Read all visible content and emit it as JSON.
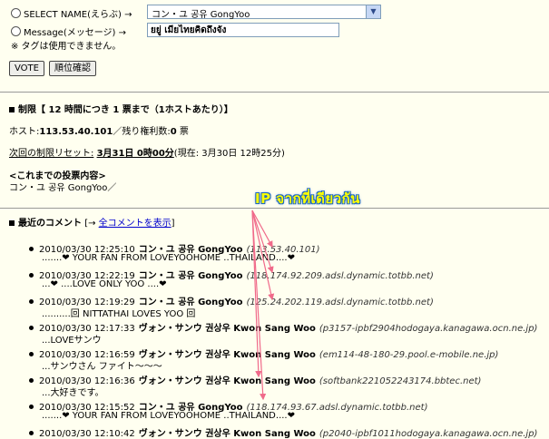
{
  "vote_form": {
    "select_label": "SELECT NAME(えらぶ)",
    "arrow": "→",
    "select_value": "コン・ユ  공유  GongYoo",
    "message_label": "Message(メッセージ)",
    "message_value": "ยยู่ เมียไทยคิดถึงจัง",
    "notice": "※ タグは使用できません。",
    "vote_button": "VOTE",
    "rank_button": "順位確認"
  },
  "limits": {
    "title": "制限【 12 時間につき 1 票まで（1ホストあたり）】",
    "host_line_prefix": "ホスト:",
    "host": "113.53.40.101",
    "remaining_label": "／残り権利数:",
    "remaining": "0",
    "remaining_unit": "票",
    "reset_label": "次回の制限リセット:",
    "reset_time": "3月31日 0時00分",
    "now_text": "(現在: 3月30日 12時25分)",
    "history_title": "<これまでの投票内容>",
    "history_value": "コン・ユ  공유  GongYoo／"
  },
  "recent": {
    "title": "最近のコメント",
    "bracket_open": "[→",
    "all_link": "全コメントを表示",
    "bracket_close": "]",
    "items": [
      {
        "time": "2010/03/30 12:25:10",
        "name": "コン・ユ  공유  GongYoo",
        "host": "(113.53.40.101)",
        "body": ".......❤ YOUR FAN FROM LOVEYOOHOME ..THAILAND....❤"
      },
      {
        "time": "2010/03/30 12:22:19",
        "name": "コン・ユ  공유  GongYoo",
        "host": "(118.174.92.209.adsl.dynamic.totbb.net)",
        "body": "...❤ ....LOVE ONLY YOO ....❤"
      },
      {
        "time": "2010/03/30 12:19:29",
        "name": "コン・ユ  공유  GongYoo",
        "host": "(125.24.202.119.adsl.dynamic.totbb.net)",
        "body": "..........回 NITTATHAI LOVES YOO 回"
      },
      {
        "time": "2010/03/30 12:17:33",
        "name": "ヴォン・サンウ  권상우  Kwon Sang Woo",
        "host": "(p3157-ipbf2904hodogaya.kanagawa.ocn.ne.jp)",
        "body": "...LOVEサンウ"
      },
      {
        "time": "2010/03/30 12:16:59",
        "name": "ヴォン・サンウ  권상우  Kwon Sang Woo",
        "host": "(em114-48-180-29.pool.e-mobile.ne.jp)",
        "body": "...サンウさん ファイト～～～"
      },
      {
        "time": "2010/03/30 12:16:36",
        "name": "ヴォン・サンウ  권상우  Kwon Sang Woo",
        "host": "(softbank221052243174.bbtec.net)",
        "body": "...大好きです。"
      },
      {
        "time": "2010/03/30 12:15:52",
        "name": "コン・ユ  공유  GongYoo",
        "host": "(118.174.93.67.adsl.dynamic.totbb.net)",
        "body": ".......❤ YOUR FAN FROM LOVEYOOHOME ..THAILAND....❤"
      },
      {
        "time": "2010/03/30 12:10:42",
        "name": "ヴォン・サンウ  권상우  Kwon Sang Woo",
        "host": "(p2040-ipbf1011hodogaya.kanagawa.ocn.ne.jp)",
        "body": ""
      }
    ]
  },
  "annotation": {
    "text": "IP จากที่เดียวกัน",
    "color": "#ffff00",
    "arrow_color": "#f06a8a"
  }
}
